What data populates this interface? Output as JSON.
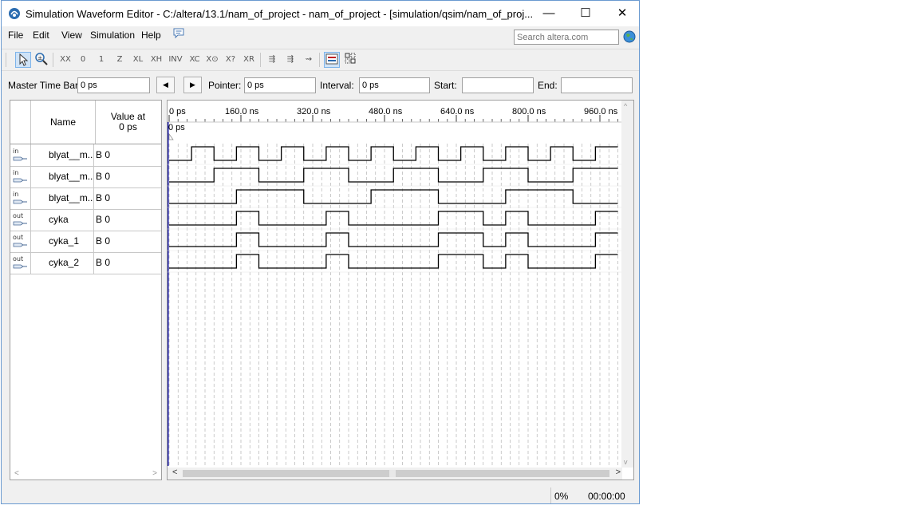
{
  "window": {
    "title": "Simulation Waveform Editor - C:/altera/13.1/nam_of_project - nam_of_project - [simulation/qsim/nam_of_proj...",
    "minimize_glyph": "—",
    "maximize_glyph": "☐",
    "close_glyph": "✕"
  },
  "menu": {
    "items": [
      "File",
      "Edit",
      "View",
      "Simulation",
      "Help"
    ]
  },
  "search": {
    "placeholder": "Search altera.com"
  },
  "toolbar": {
    "icons": [
      "selection-tool-icon",
      "zoom-tool-icon",
      "uninitialized-icon",
      "force-low-icon",
      "force-high-icon",
      "high-impedance-icon",
      "weak-low-icon",
      "weak-high-icon",
      "invert-icon",
      "count-value-icon",
      "clock-icon",
      "random-value-icon",
      "dont-care-icon",
      "arbitrary-value-icon",
      "run-functional-simulation-icon",
      "run-timing-simulation-icon",
      "generate-netlist-icon",
      "waveform-compare-icon",
      "snap-to-grid-icon"
    ]
  },
  "timebar": {
    "master_label": "Master Time Bar:",
    "master_value": "0 ps",
    "prev_glyph": "◀",
    "next_glyph": "▶",
    "pointer_label": "Pointer:",
    "pointer_value": "0 ps",
    "interval_label": "Interval:",
    "interval_value": "0 ps",
    "start_label": "Start:",
    "start_value": "",
    "end_label": "End:",
    "end_value": ""
  },
  "names_panel": {
    "col_name": "Name",
    "col_value_line1": "Value at",
    "col_value_line2": "0 ps",
    "signals": [
      {
        "dir": "in",
        "name": "blyat__m...",
        "value": "B 0"
      },
      {
        "dir": "in",
        "name": "blyat__m...",
        "value": "B 0"
      },
      {
        "dir": "in",
        "name": "blyat__m...",
        "value": "B 0"
      },
      {
        "dir": "out",
        "name": "cyka",
        "value": "B 0"
      },
      {
        "dir": "out",
        "name": "cyka_1",
        "value": "B 0"
      },
      {
        "dir": "out",
        "name": "cyka_2",
        "value": "B 0"
      }
    ]
  },
  "waveform": {
    "time_ticks": [
      "0 ps",
      "160.0 ns",
      "320.0 ns",
      "480.0 ns",
      "640.0 ns",
      "800.0 ns",
      "960.0 ns"
    ],
    "cursor_label": "0 ps",
    "time_unit_per_tick_ns": 160,
    "visible_end_ns": 1000,
    "grid_step_ns": 20,
    "signals": [
      {
        "period_ns": 100,
        "start_high": false
      },
      {
        "period_ns": 200,
        "start_high": false
      },
      {
        "period_ns": 300,
        "start_high": false
      },
      {
        "period_ns": 200,
        "start_high": false,
        "custom": [
          [
            0,
            150,
            0
          ],
          [
            150,
            200,
            1
          ],
          [
            200,
            350,
            0
          ],
          [
            350,
            400,
            1
          ],
          [
            400,
            600,
            0
          ],
          [
            600,
            700,
            1
          ],
          [
            700,
            750,
            0
          ],
          [
            750,
            800,
            1
          ],
          [
            800,
            950,
            0
          ],
          [
            950,
            1000,
            1
          ]
        ]
      },
      {
        "period_ns": 200,
        "start_high": false,
        "custom": [
          [
            0,
            150,
            0
          ],
          [
            150,
            200,
            1
          ],
          [
            200,
            350,
            0
          ],
          [
            350,
            400,
            1
          ],
          [
            400,
            600,
            0
          ],
          [
            600,
            700,
            1
          ],
          [
            700,
            750,
            0
          ],
          [
            750,
            800,
            1
          ],
          [
            800,
            950,
            0
          ],
          [
            950,
            1000,
            1
          ]
        ]
      },
      {
        "period_ns": 200,
        "start_high": false,
        "custom": [
          [
            0,
            150,
            0
          ],
          [
            150,
            200,
            1
          ],
          [
            200,
            350,
            0
          ],
          [
            350,
            400,
            1
          ],
          [
            400,
            600,
            0
          ],
          [
            600,
            700,
            1
          ],
          [
            700,
            750,
            0
          ],
          [
            750,
            800,
            1
          ],
          [
            800,
            950,
            0
          ],
          [
            950,
            1000,
            1
          ]
        ]
      }
    ]
  },
  "status": {
    "progress": "0%",
    "elapsed": "00:00:00"
  }
}
